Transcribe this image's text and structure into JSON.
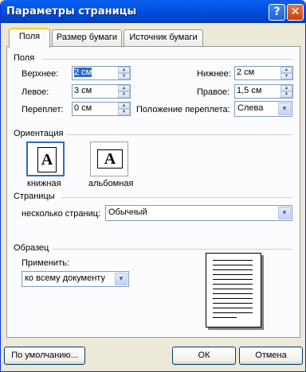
{
  "window": {
    "title": "Параметры страницы"
  },
  "titlebar_buttons": {
    "help": "?",
    "close": "✕"
  },
  "tabs": [
    {
      "label": "Поля",
      "active": true
    },
    {
      "label": "Размер бумаги",
      "active": false
    },
    {
      "label": "Источник бумаги",
      "active": false
    }
  ],
  "margins": {
    "group_label": "Поля",
    "top": {
      "label": "Верхнее:",
      "value": "2 см"
    },
    "bottom": {
      "label": "Нижнее:",
      "value": "2 см"
    },
    "left": {
      "label": "Левое:",
      "value": "3 см"
    },
    "right": {
      "label": "Правое:",
      "value": "1,5 см"
    },
    "gutter": {
      "label": "Переплет:",
      "value": "0 см"
    },
    "gutter_position": {
      "label": "Положение переплета:",
      "value": "Слева"
    }
  },
  "orientation": {
    "group_label": "Ориентация",
    "portrait": {
      "label": "книжная",
      "glyph": "A",
      "selected": true
    },
    "landscape": {
      "label": "альбомная",
      "glyph": "A",
      "selected": false
    }
  },
  "pages": {
    "group_label": "Страницы",
    "multiple_label": "несколько страниц:",
    "multiple_value": "Обычный"
  },
  "preview": {
    "group_label": "Образец",
    "apply_label": "Применить:",
    "apply_value": "ко всему документу"
  },
  "buttons": {
    "default": "По умолчанию...",
    "ok": "ОК",
    "cancel": "Отмена"
  },
  "colors": {
    "title_bar": "#0054e3",
    "selection": "#316ac5",
    "dialog_bg": "#ece9d8"
  }
}
